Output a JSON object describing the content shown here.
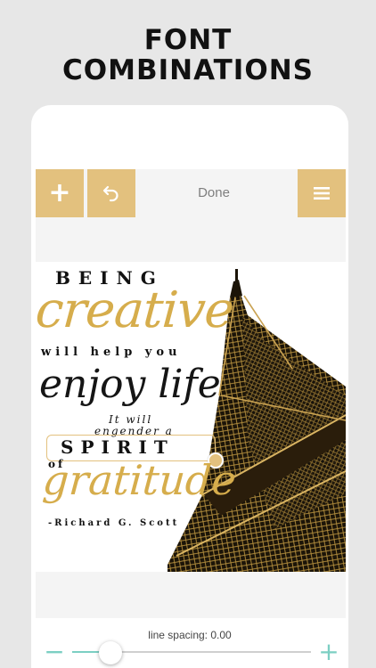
{
  "headline": {
    "line1": "FONT",
    "line2": "COMBINATIONS"
  },
  "toolbar": {
    "done_label": "Done",
    "add_icon": "plus-icon",
    "undo_icon": "undo-arrow-icon",
    "menu_icon": "hamburger-menu-icon"
  },
  "quote": {
    "being": "BEING",
    "creative": "creative",
    "will_help_you": "will help you",
    "enjoy_life": "enjoy life",
    "it_will": "It will",
    "engender_a": "engender a",
    "spirit": "SPIRIT",
    "of": "of",
    "gratitude": "gratitude",
    "author": "-Richard G. Scott"
  },
  "controls": {
    "line_spacing_label": "line spacing:  0.00",
    "line_spacing_level": 0.16
  },
  "colors": {
    "accent_gold": "#e3c17e",
    "slider_teal": "#7ccfc3",
    "headline_text": "#111111"
  }
}
